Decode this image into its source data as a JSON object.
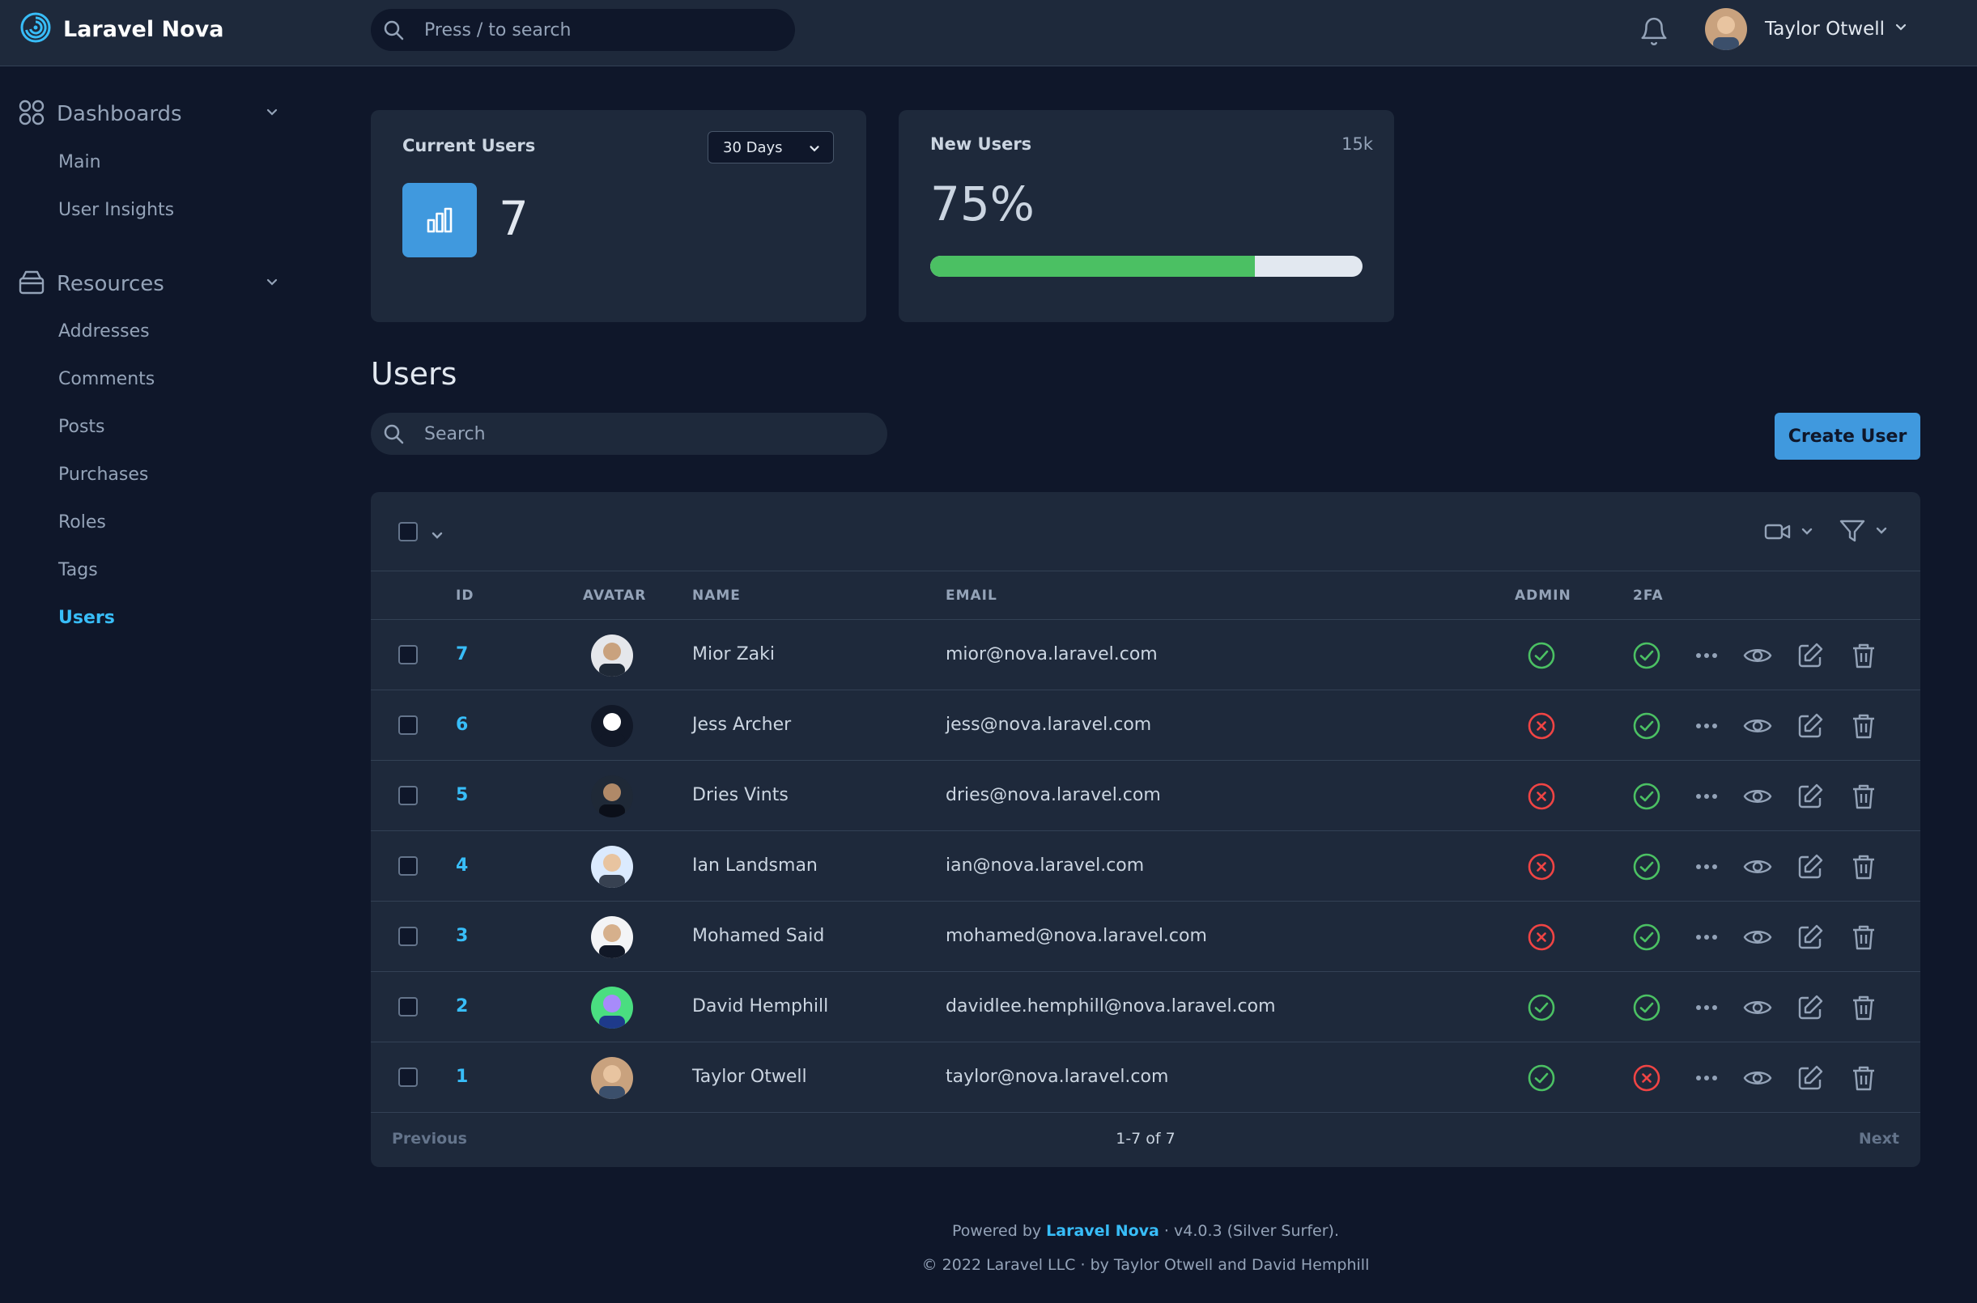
{
  "app": {
    "name": "Laravel Nova"
  },
  "topbar": {
    "search_placeholder": "Press / to search",
    "user_name": "Taylor Otwell"
  },
  "sidebar": {
    "groups": [
      {
        "label": "Dashboards",
        "icon": "grid-icon",
        "items": [
          {
            "label": "Main"
          },
          {
            "label": "User Insights"
          }
        ]
      },
      {
        "label": "Resources",
        "icon": "archive-icon",
        "items": [
          {
            "label": "Addresses"
          },
          {
            "label": "Comments"
          },
          {
            "label": "Posts"
          },
          {
            "label": "Purchases"
          },
          {
            "label": "Roles"
          },
          {
            "label": "Tags"
          },
          {
            "label": "Users",
            "active": true
          }
        ]
      }
    ]
  },
  "cards": {
    "current_users": {
      "title": "Current Users",
      "range": "30 Days",
      "value": "7"
    },
    "new_users": {
      "title": "New Users",
      "max": "15k",
      "percent_label": "75%",
      "progress": 0.75
    }
  },
  "users": {
    "heading": "Users",
    "search_placeholder": "Search",
    "create_label": "Create User",
    "columns": {
      "id": "ID",
      "avatar": "AVATAR",
      "name": "NAME",
      "email": "EMAIL",
      "admin": "ADMIN",
      "twofa": "2FA"
    },
    "rows": [
      {
        "id": "7",
        "name": "Mior Zaki",
        "email": "mior@nova.laravel.com",
        "admin": true,
        "twofa": true
      },
      {
        "id": "6",
        "name": "Jess Archer",
        "email": "jess@nova.laravel.com",
        "admin": false,
        "twofa": true
      },
      {
        "id": "5",
        "name": "Dries Vints",
        "email": "dries@nova.laravel.com",
        "admin": false,
        "twofa": true
      },
      {
        "id": "4",
        "name": "Ian Landsman",
        "email": "ian@nova.laravel.com",
        "admin": false,
        "twofa": true
      },
      {
        "id": "3",
        "name": "Mohamed Said",
        "email": "mohamed@nova.laravel.com",
        "admin": false,
        "twofa": true
      },
      {
        "id": "2",
        "name": "David Hemphill",
        "email": "davidlee.hemphill@nova.laravel.com",
        "admin": true,
        "twofa": true
      },
      {
        "id": "1",
        "name": "Taylor Otwell",
        "email": "taylor@nova.laravel.com",
        "admin": true,
        "twofa": false
      }
    ],
    "pagination": {
      "previous": "Previous",
      "info": "1-7 of 7",
      "next": "Next"
    }
  },
  "footer": {
    "powered_prefix": "Powered by",
    "powered_brand": "Laravel Nova",
    "powered_suffix": "· v4.0.3 (Silver Surfer).",
    "copyright": "© 2022 Laravel LLC · by Taylor Otwell and David Hemphill"
  },
  "colors": {
    "accent": "#38bdf8",
    "button": "#4099de",
    "success": "#4bc063",
    "danger": "#ef4444",
    "background": "#0f172a",
    "panel": "#1e293b"
  }
}
